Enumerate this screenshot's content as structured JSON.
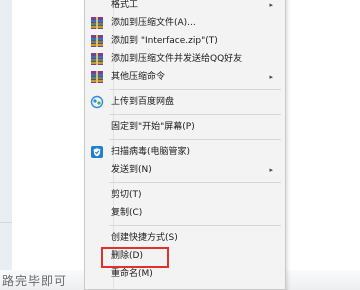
{
  "context_menu": {
    "items": [
      {
        "label": "格式工",
        "icon": "none",
        "submenu": true
      },
      {
        "label": "添加到压缩文件(A)...",
        "icon": "winrar-archive-icon",
        "submenu": false
      },
      {
        "label": "添加到 \"Interface.zip\"(T)",
        "icon": "winrar-archive-icon",
        "submenu": false
      },
      {
        "label": "添加到压缩文件并发送给QQ好友",
        "icon": "winrar-archive-icon",
        "submenu": false
      },
      {
        "label": "其他压缩命令",
        "icon": "winrar-archive-icon",
        "submenu": true
      },
      {
        "label": "上传到百度网盘",
        "icon": "baidu-netdisk-icon",
        "submenu": false
      },
      {
        "label": "固定到\"开始\"屏幕(P)",
        "icon": "none",
        "submenu": false
      },
      {
        "label": "扫描病毒(电脑管家)",
        "icon": "pc-manager-shield-icon",
        "submenu": false
      },
      {
        "label": "发送到(N)",
        "icon": "none",
        "submenu": true
      },
      {
        "label": "剪切(T)",
        "icon": "none",
        "submenu": false
      },
      {
        "label": "复制(C)",
        "icon": "none",
        "submenu": false
      },
      {
        "label": "创建快捷方式(S)",
        "icon": "none",
        "submenu": false
      },
      {
        "label": "删除(D)",
        "icon": "none",
        "submenu": false,
        "highlighted": true
      },
      {
        "label": "重命名(M)",
        "icon": "none",
        "submenu": false
      }
    ],
    "submenu_arrow": "▸"
  },
  "background": {
    "bottom_text": "路完毕即可"
  },
  "colors": {
    "menu_bg": "#f3f3f3",
    "highlight_border": "#e0312c",
    "shield_blue": "#1e7fd6"
  }
}
